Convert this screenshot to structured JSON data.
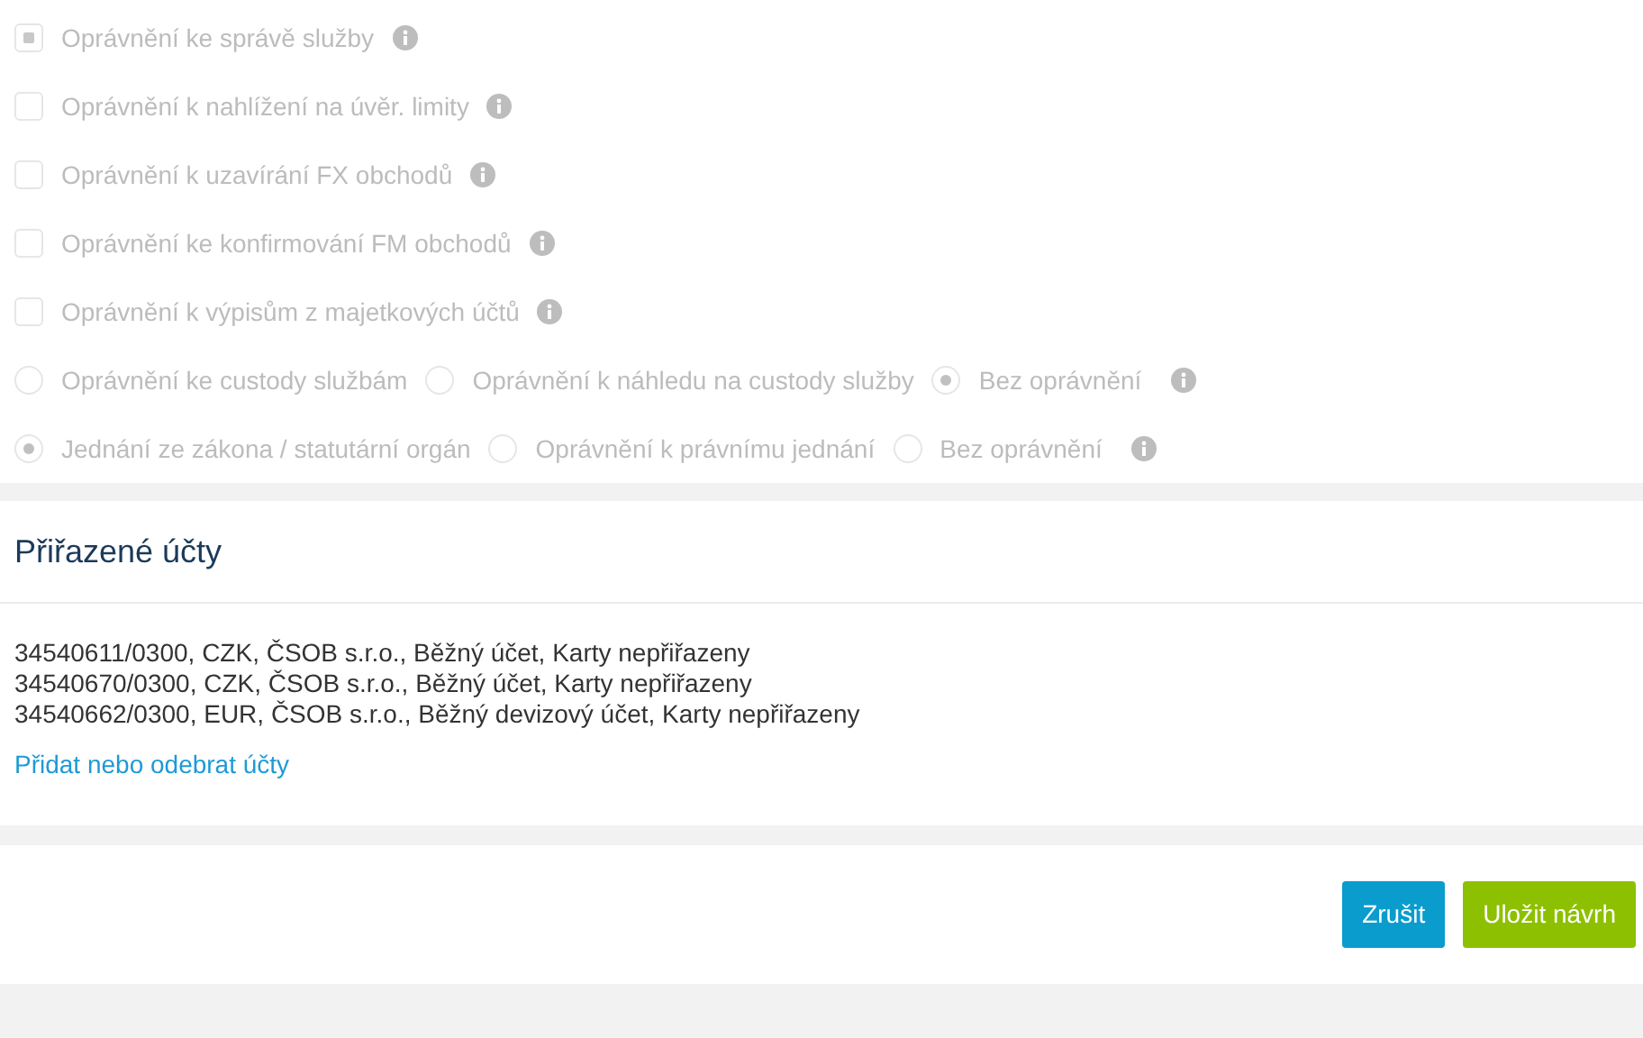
{
  "permissions": [
    {
      "kind": "checkbox",
      "label": "Oprávnění ke správě služby",
      "checked": true
    },
    {
      "kind": "checkbox",
      "label": "Oprávnění k nahlížení na úvěr. limity",
      "checked": false
    },
    {
      "kind": "checkbox",
      "label": "Oprávnění k uzavírání FX obchodů",
      "checked": false
    },
    {
      "kind": "checkbox",
      "label": "Oprávnění ke konfirmování FM obchodů",
      "checked": false
    },
    {
      "kind": "checkbox",
      "label": "Oprávnění k výpisům z majetkových účtů",
      "checked": false
    },
    {
      "kind": "radio",
      "options": [
        {
          "label": "Oprávnění ke custody službám",
          "selected": false
        },
        {
          "label": "Oprávnění k náhledu na custody služby",
          "selected": false
        },
        {
          "label": "Bez oprávnění",
          "selected": true
        }
      ]
    },
    {
      "kind": "radio",
      "options": [
        {
          "label": "Jednání ze zákona / statutární orgán",
          "selected": true
        },
        {
          "label": "Oprávnění k právnímu jednání",
          "selected": false
        },
        {
          "label": "Bez oprávnění",
          "selected": false
        }
      ]
    }
  ],
  "assigned_accounts": {
    "title": "Přiřazené účty",
    "accounts": [
      "34540611/0300, CZK, ČSOB s.r.o., Běžný účet, Karty nepřiřazeny",
      "34540670/0300, CZK, ČSOB s.r.o., Běžný účet, Karty nepřiřazeny",
      "34540662/0300, EUR, ČSOB s.r.o., Běžný devizový účet, Karty nepřiřazeny"
    ],
    "link": "Přidat nebo odebrat účty"
  },
  "buttons": [
    {
      "kind": "cancel",
      "label": "Zrušit"
    },
    {
      "kind": "primary",
      "label": "Uložit návrh"
    }
  ]
}
